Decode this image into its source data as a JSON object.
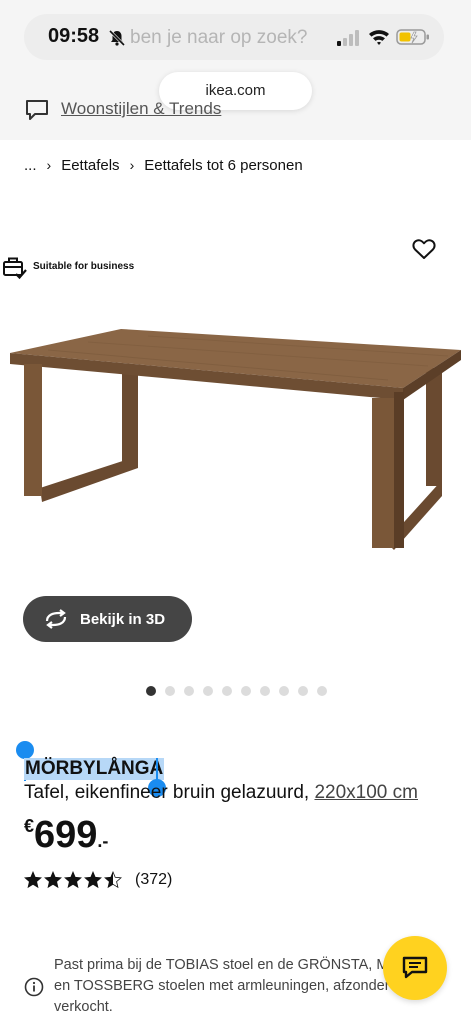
{
  "status_bar": {
    "time": "09:58"
  },
  "browser": {
    "search_placeholder": "ben je naar op zoek?",
    "url": "ikea.com"
  },
  "nav": {
    "woonstijlen_link": "Woonstijlen & Trends"
  },
  "breadcrumb": {
    "items": [
      "...",
      "Eettafels",
      "Eettafels tot 6 personen"
    ],
    "separator": "›"
  },
  "product": {
    "business_label": "Suitable for business",
    "view_3d_label": "Bekijk in 3D",
    "image_count": 10,
    "active_image_index": 0,
    "name": "MÖRBYLÅNGA",
    "description": "Tafel, eikenfineer bruin gelazuurd,",
    "size": "220x100 cm",
    "price_currency": "€",
    "price_integer": "699",
    "price_decimal": ".-",
    "rating_value": 4.5,
    "rating_max": 5,
    "rating_count": "(372)"
  },
  "info_note": {
    "text": "Past prima bij de TOBIAS stoel en de GRÖNSTA, M... en TOSSBERG stoelen met armleuningen, afzonderlijk verkocht.",
    "line1": "Past prima bij de TOBIAS stoel en de GRÖNSTA, MÅ",
    "line2": "en TOSSBERG stoelen met armleuningen, afzonder",
    "line3": "verkocht."
  },
  "colors": {
    "accent_yellow": "#ffd21f",
    "selection_blue": "#1a8cf0",
    "button_dark": "#454545"
  },
  "icons": {
    "chat": "chat-bubble-icon",
    "heart": "heart-icon",
    "business": "briefcase-check-icon",
    "rotate": "rotate-3d-icon",
    "info": "info-icon"
  }
}
